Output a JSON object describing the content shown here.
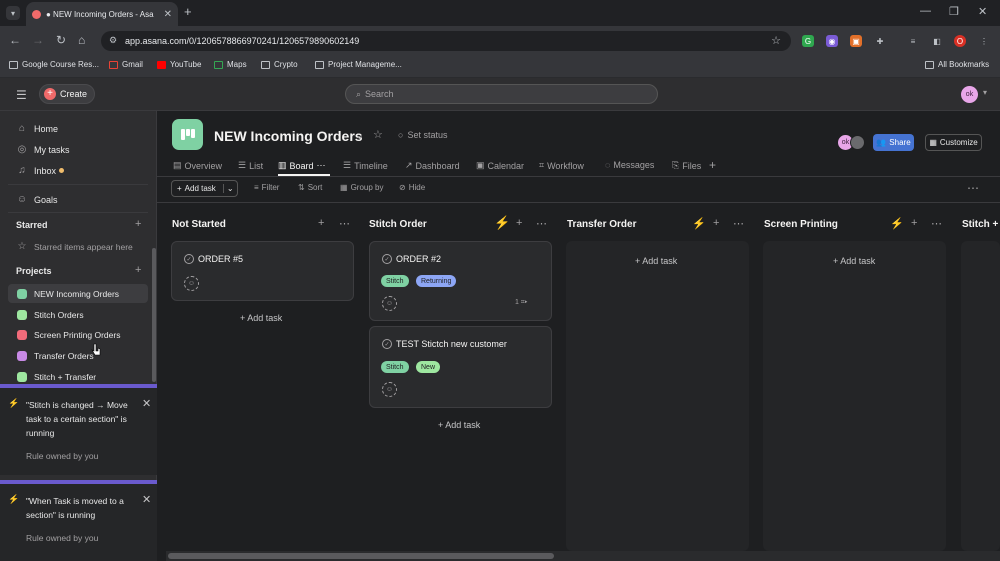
{
  "browser": {
    "tab_title": "● NEW Incoming Orders - Asa",
    "url": "app.asana.com/0/1206578866970241/1206579890602149",
    "bookmarks": [
      "Google Course Res...",
      "Gmail",
      "YouTube",
      "Maps",
      "Crypto",
      "Project Manageme..."
    ],
    "all_bookmarks": "All Bookmarks",
    "profile_initial": "O"
  },
  "header": {
    "create_label": "Create",
    "search_placeholder": "Search",
    "avatar_initials": "ok"
  },
  "sidebar": {
    "nav": [
      {
        "label": "Home",
        "icon": "home-icon"
      },
      {
        "label": "My tasks",
        "icon": "check-circle-icon"
      },
      {
        "label": "Inbox",
        "icon": "bell-icon"
      },
      {
        "label": "Goals",
        "icon": "person-icon"
      }
    ],
    "starred_heading": "Starred",
    "starred_empty": "Starred items appear here",
    "projects_heading": "Projects",
    "projects": [
      {
        "label": "NEW Incoming Orders",
        "color": "#7fd1a3"
      },
      {
        "label": "Stitch Orders",
        "color": "#9ee7a0"
      },
      {
        "label": "Screen Printing Orders",
        "color": "#f26b7a"
      },
      {
        "label": "Transfer Orders",
        "color": "#c88ae6"
      },
      {
        "label": "Stitch + Transfer",
        "color": "#9ee7a0"
      }
    ]
  },
  "toasts": [
    {
      "title": "\"Stitch is changed → Move task to a certain section\" is running",
      "subtitle": "Rule owned by you"
    },
    {
      "title": "\"When Task is moved to a section\" is running",
      "subtitle": "Rule owned by you"
    }
  ],
  "project": {
    "title": "NEW Incoming Orders",
    "set_status": "Set status",
    "share_label": "Share",
    "customize_label": "Customize",
    "member_initials": "ok"
  },
  "view_tabs": [
    "Overview",
    "List",
    "Board",
    "Timeline",
    "Dashboard",
    "Calendar",
    "Workflow",
    "Messages",
    "Files"
  ],
  "toolbar": {
    "add_task": "Add task",
    "filter": "Filter",
    "sort": "Sort",
    "group_by": "Group by",
    "hide": "Hide"
  },
  "board": {
    "add_task_link": "Add task",
    "columns": [
      {
        "name": "Not Started"
      },
      {
        "name": "Stitch Order"
      },
      {
        "name": "Transfer Order"
      },
      {
        "name": "Screen Printing"
      },
      {
        "name": "Stitch +"
      }
    ],
    "cards": [
      {
        "title": "ORDER #5"
      },
      {
        "title": "ORDER #2",
        "tags": [
          {
            "label": "Stitch",
            "color": "#7fd1a3"
          },
          {
            "label": "Returning",
            "color": "#8da6f5"
          }
        ],
        "subtasks": "1"
      },
      {
        "title": "TEST Stictch new customer",
        "tags": [
          {
            "label": "Stitch",
            "color": "#7fd1a3"
          },
          {
            "label": "New",
            "color": "#9ee7a0"
          }
        ]
      }
    ]
  }
}
